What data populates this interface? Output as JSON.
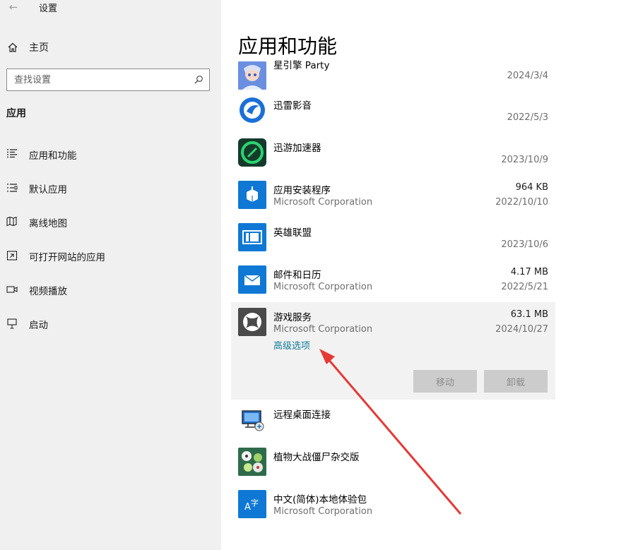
{
  "window": {
    "title": "设置",
    "back_glyph": "←"
  },
  "sidebar": {
    "home_label": "主页",
    "search_placeholder": "查找设置",
    "section_title": "应用",
    "items": [
      {
        "label": "应用和功能",
        "icon": "apps-features-icon"
      },
      {
        "label": "默认应用",
        "icon": "default-apps-icon"
      },
      {
        "label": "离线地图",
        "icon": "offline-maps-icon"
      },
      {
        "label": "可打开网站的应用",
        "icon": "apps-for-websites-icon"
      },
      {
        "label": "视频播放",
        "icon": "video-playback-icon"
      },
      {
        "label": "启动",
        "icon": "startup-icon"
      }
    ]
  },
  "main": {
    "title": "应用和功能",
    "apps": [
      {
        "name": "星引擎 Party",
        "publisher": "",
        "size": "",
        "date": "2024/3/4",
        "icon": "star-engine-party-icon"
      },
      {
        "name": "迅雷影音",
        "publisher": "",
        "size": "",
        "date": "2022/5/3",
        "icon": "xunlei-player-icon"
      },
      {
        "name": "迅游加速器",
        "publisher": "",
        "size": "",
        "date": "2023/10/9",
        "icon": "xunyou-accelerator-icon"
      },
      {
        "name": "应用安装程序",
        "publisher": "Microsoft Corporation",
        "size": "964 KB",
        "date": "2022/10/10",
        "icon": "app-installer-icon"
      },
      {
        "name": "英雄联盟",
        "publisher": "",
        "size": "",
        "date": "2023/10/6",
        "icon": "league-of-legends-icon"
      },
      {
        "name": "邮件和日历",
        "publisher": "Microsoft Corporation",
        "size": "4.17 MB",
        "date": "2022/5/21",
        "icon": "mail-calendar-icon"
      },
      {
        "name": "游戏服务",
        "publisher": "Microsoft Corporation",
        "size": "63.1 MB",
        "date": "2024/10/27",
        "icon": "xbox-icon"
      },
      {
        "name": "远程桌面连接",
        "publisher": "",
        "size": "",
        "date": "",
        "icon": "remote-desktop-icon"
      },
      {
        "name": "植物大战僵尸杂交版",
        "publisher": "",
        "size": "",
        "date": "",
        "icon": "pvz-hybrid-icon"
      },
      {
        "name": "中文(简体)本地体验包",
        "publisher": "Microsoft Corporation",
        "size": "",
        "date": "",
        "icon": "language-pack-icon"
      }
    ],
    "selected": {
      "advanced_link": "高级选项",
      "move_label": "移动",
      "uninstall_label": "卸载"
    }
  },
  "colors": {
    "sidebar_bg": "#f0f0f0",
    "accent_link": "#0f7a99",
    "tile_blue": "#0f78d4",
    "annotation_arrow": "#e53935"
  }
}
